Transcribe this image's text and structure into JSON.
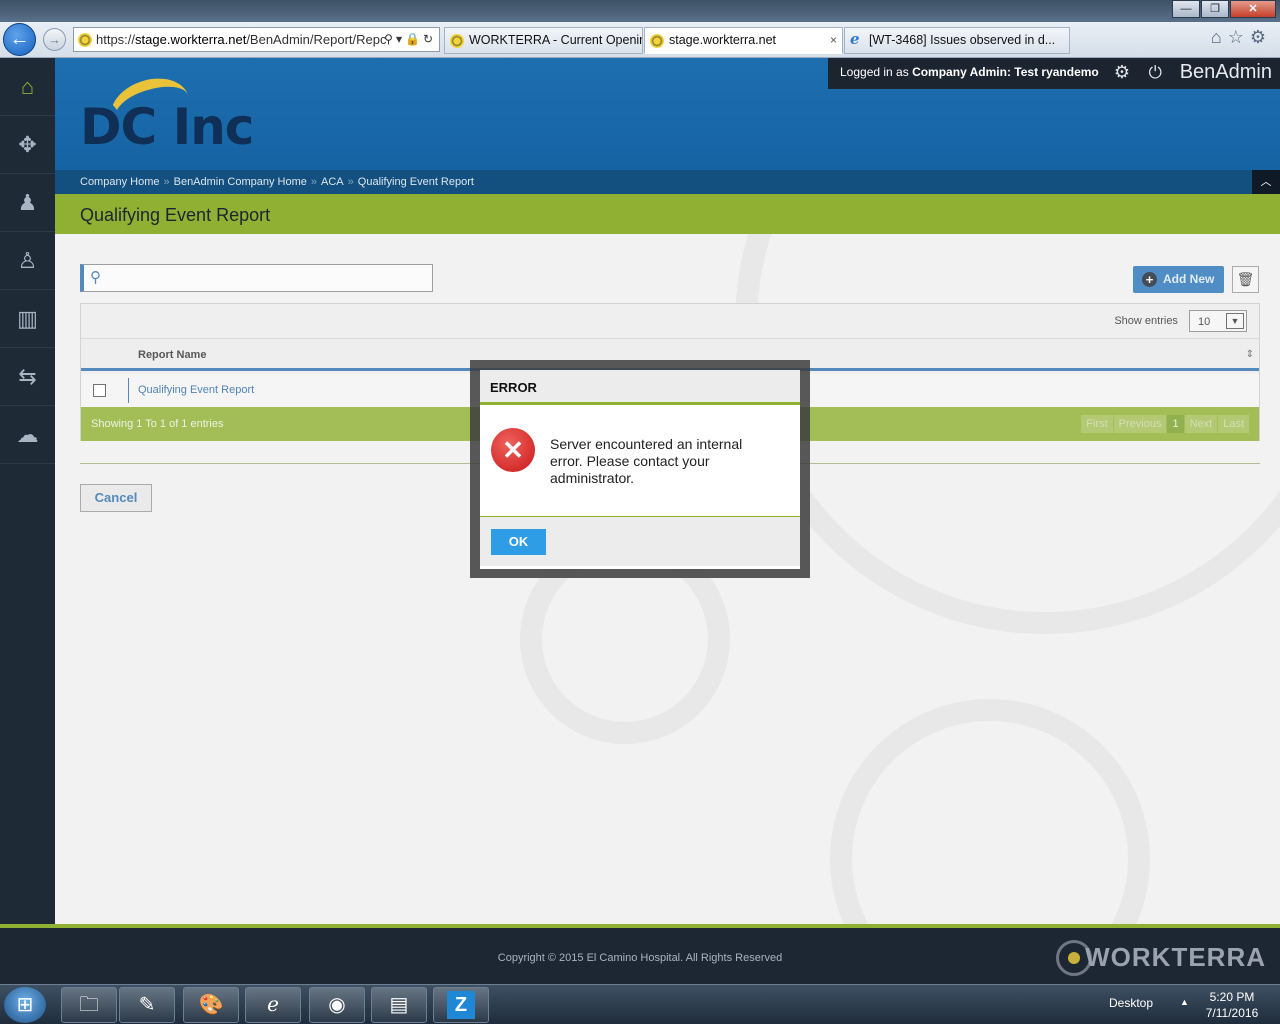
{
  "browser": {
    "address": {
      "prefix": "https://",
      "host": "stage.workterra.net",
      "path": "/BenAdmin/Report/Repc"
    },
    "tabs": [
      {
        "label": "WORKTERRA - Current Openin...",
        "active": false
      },
      {
        "label": "stage.workterra.net",
        "active": true
      },
      {
        "label": "[WT-3468] Issues observed in d...",
        "active": false
      }
    ],
    "tab_close": "×",
    "window_buttons": {
      "minimize": "—",
      "maximize": "❐",
      "close": "✕"
    }
  },
  "userbar": {
    "prefix": "Logged in as ",
    "role": "Company Admin:",
    "name": " Test ryandemo",
    "brand": "BenAdmin"
  },
  "logo": {
    "text": "DC Inc"
  },
  "breadcrumb": [
    "Company Home",
    "BenAdmin Company Home",
    "ACA",
    "Qualifying Event Report"
  ],
  "breadcrumb_sep": "»",
  "page_title": "Qualifying Event Report",
  "toolbar": {
    "add_new": "Add New"
  },
  "table": {
    "show_entries_label": "Show entries",
    "show_entries_value": "10",
    "columns": [
      "Report Name"
    ],
    "rows": [
      {
        "name": "Qualifying Event Report"
      }
    ],
    "footer_text": "Showing 1 To 1 of 1 entries",
    "pager": {
      "first": "First",
      "previous": "Previous",
      "current": "1",
      "next": "Next",
      "last": "Last"
    }
  },
  "cancel_label": "Cancel",
  "modal": {
    "title": "ERROR",
    "message": "Server encountered an internal error. Please contact your administrator.",
    "ok_label": "OK"
  },
  "footer": {
    "copyright": "Copyright © 2015 El Camino Hospital. All Rights Reserved",
    "brand": "WORKTERRA"
  },
  "taskbar": {
    "desktop_label": "Desktop",
    "time": "5:20 PM",
    "date": "7/11/2016"
  },
  "colors": {
    "accent_green": "#8fb033",
    "header_blue": "#1d6fb0",
    "error_red": "#d0201f",
    "ok_blue": "#2f9ce6"
  }
}
